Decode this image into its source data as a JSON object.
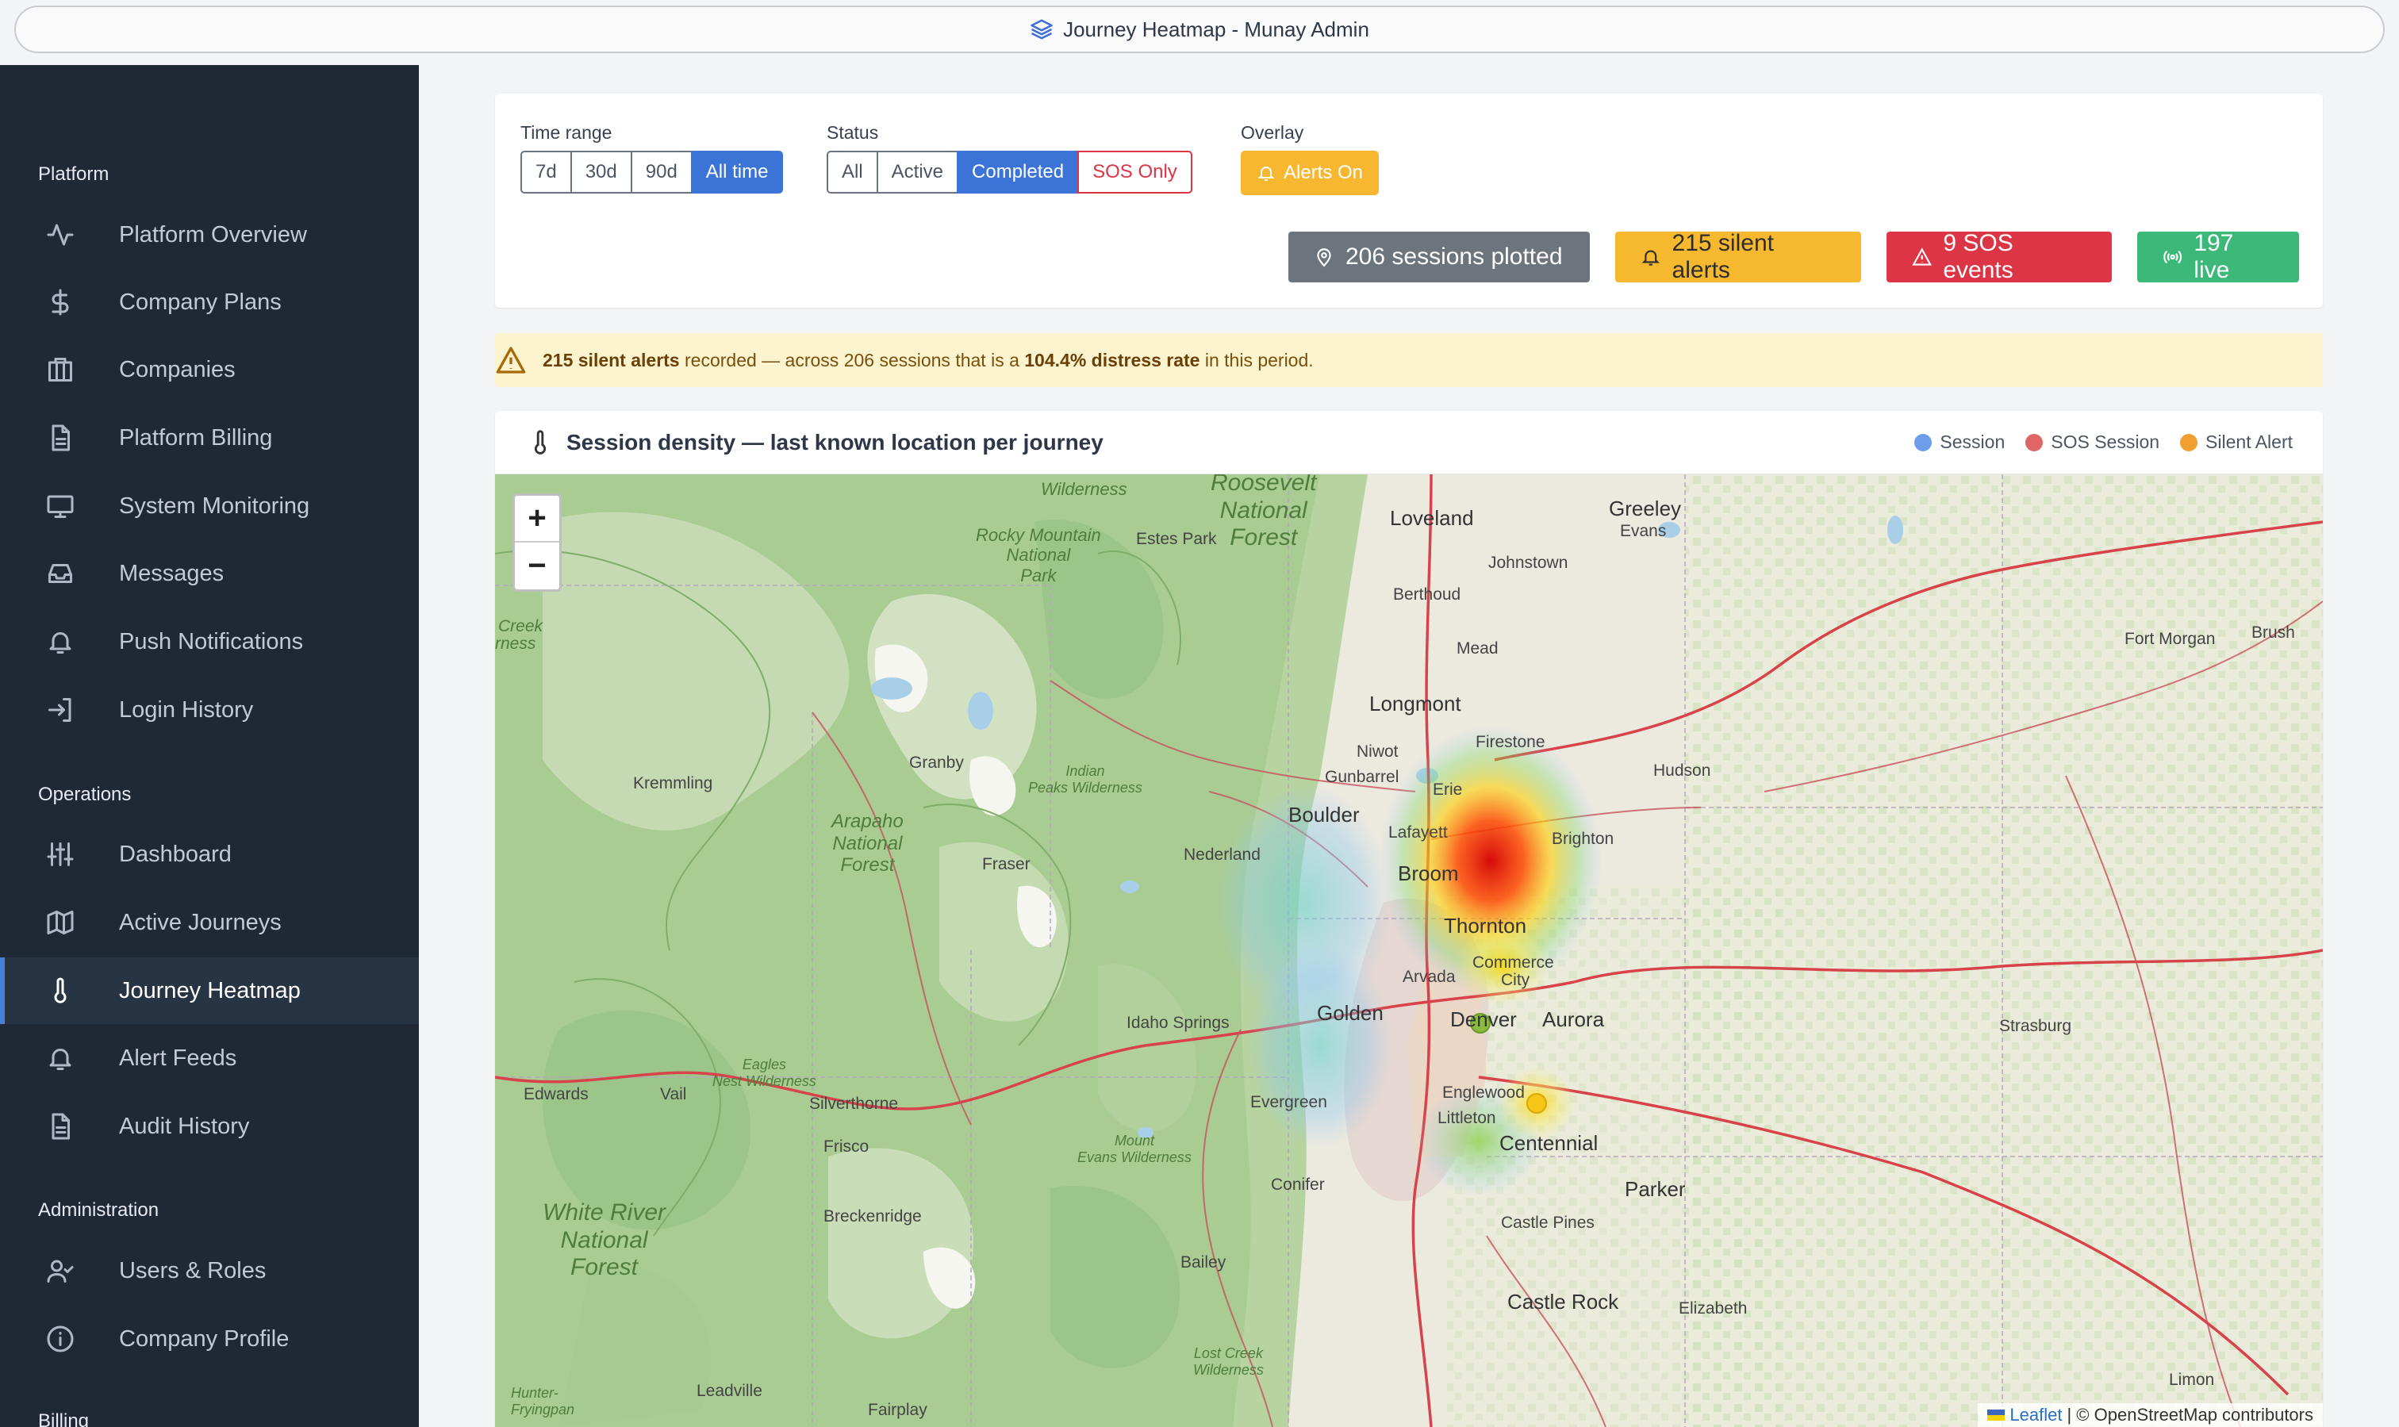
{
  "window": {
    "title": "Journey Heatmap - Munay Admin"
  },
  "sidebar": {
    "sections": [
      {
        "label": "Platform"
      },
      {
        "label": "Operations"
      },
      {
        "label": "Administration"
      },
      {
        "label": "Billing"
      }
    ],
    "items": [
      {
        "label": "Platform Overview",
        "icon": "activity-icon"
      },
      {
        "label": "Company Plans",
        "icon": "dollar-icon"
      },
      {
        "label": "Companies",
        "icon": "building-icon"
      },
      {
        "label": "Platform Billing",
        "icon": "document-icon"
      },
      {
        "label": "System Monitoring",
        "icon": "monitor-icon"
      },
      {
        "label": "Messages",
        "icon": "inbox-icon"
      },
      {
        "label": "Push Notifications",
        "icon": "bell-icon"
      },
      {
        "label": "Login History",
        "icon": "login-icon"
      },
      {
        "label": "Dashboard",
        "icon": "sliders-icon"
      },
      {
        "label": "Active Journeys",
        "icon": "map-icon"
      },
      {
        "label": "Journey Heatmap",
        "icon": "thermometer-icon"
      },
      {
        "label": "Alert Feeds",
        "icon": "bell-icon"
      },
      {
        "label": "Audit History",
        "icon": "document-icon"
      },
      {
        "label": "Users & Roles",
        "icon": "user-check-icon"
      },
      {
        "label": "Company Profile",
        "icon": "info-icon"
      }
    ]
  },
  "filters": {
    "time_range": {
      "label": "Time range",
      "options": [
        "7d",
        "30d",
        "90d",
        "All time"
      ],
      "selected": "All time"
    },
    "status": {
      "label": "Status",
      "options": [
        "All",
        "Active",
        "Completed",
        "SOS Only"
      ],
      "selected": "Completed"
    },
    "overlay": {
      "label": "Overlay",
      "button": "Alerts On"
    }
  },
  "stats": {
    "sessions": "206 sessions plotted",
    "silent_alerts": "215 silent alerts",
    "sos": "9 SOS events",
    "live": "197 live"
  },
  "alert": {
    "strong1": "215 silent alerts",
    "text1": " recorded — across 206 sessions that is a ",
    "strong2": "104.4% distress rate",
    "text2": " in this period."
  },
  "map": {
    "title": "Session density — last known location per journey",
    "legend": [
      {
        "label": "Session",
        "color": "#6d9eeb"
      },
      {
        "label": "SOS Session",
        "color": "#e06666"
      },
      {
        "label": "Silent Alert",
        "color": "#f0a030"
      }
    ],
    "zoom_in": "+",
    "zoom_out": "−",
    "attribution_link": "Leaflet",
    "attribution_text": "| © OpenStreetMap contributors",
    "places": {
      "loveland": "Loveland",
      "greeley": "Greeley",
      "evans": "Evans",
      "johnstown": "Johnstown",
      "berthoud": "Berthoud",
      "estes_park": "Estes Park",
      "mead": "Mead",
      "longmont": "Longmont",
      "fort_morgan": "Fort Morgan",
      "brush": "Brush",
      "firestone": "Firestone",
      "niwot": "Niwot",
      "gunbarrel": "Gunbarrel",
      "hudson": "Hudson",
      "kremmling": "Kremmling",
      "granby": "Granby",
      "boulder": "Boulder",
      "erie": "Erie",
      "lafayette": "Lafayett",
      "brighton": "Brighton",
      "nederland": "Nederland",
      "broomfield": "Broom",
      "thornton": "Thornton",
      "fraser": "Fraser",
      "commerce_city": "Commerce",
      "city": "City",
      "arvada": "Arvada",
      "golden": "Golden",
      "denver": "Denver",
      "aurora": "Aurora",
      "idaho_springs": "Idaho Springs",
      "strasburg": "Strasburg",
      "edwards": "Edwards",
      "vail": "Vail",
      "silverthorne": "Silverthorne",
      "evergreen": "Evergreen",
      "englewood": "Englewood",
      "littleton": "Littleton",
      "centennial": "Centennial",
      "frisco": "Frisco",
      "parker": "Parker",
      "conifer": "Conifer",
      "breckenridge": "Breckenridge",
      "castle_pines": "Castle Pines",
      "bailey": "Bailey",
      "castle_rock": "Castle Rock",
      "elizabeth": "Elizabeth",
      "leadville": "Leadville",
      "fairplay": "Fairplay",
      "limon": "Limon",
      "creek": "Creek",
      "erness": "rness"
    },
    "parks": {
      "roosevelt": "Roosevelt\nNational\nForest",
      "wilderness_top": "Wilderness",
      "rocky": "Rocky Mountain\nNational\nPark",
      "arapaho": "Arapaho\nNational\nForest",
      "indian_peaks": "Indian\nPeaks Wilderness",
      "eagles_nest": "Eagles\nNest Wilderness",
      "mount_evans": "Mount\nEvans Wilderness",
      "white_river": "White River\nNational\nForest",
      "lost_creek": "Lost Creek\nWilderness",
      "hunter": "Hunter-\nFryingpan"
    }
  }
}
